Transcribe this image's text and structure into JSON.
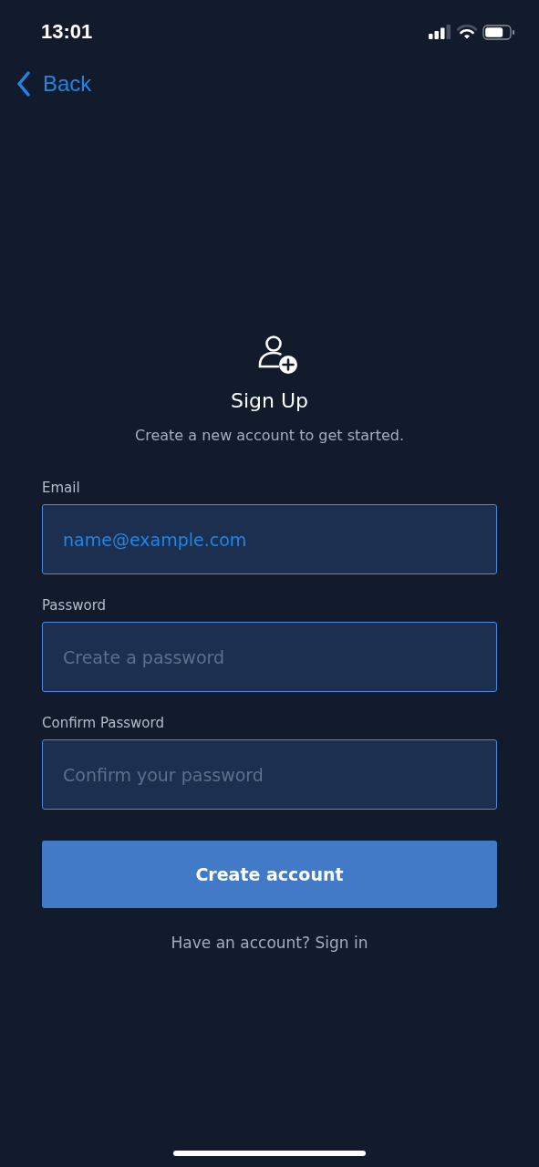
{
  "status_bar": {
    "time": "13:01"
  },
  "nav": {
    "back_label": "Back"
  },
  "header": {
    "title": "Sign Up",
    "subtitle": "Create a new account to get started."
  },
  "fields": [
    {
      "label": "Email",
      "value": "name@example.com"
    },
    {
      "label": "Password",
      "placeholder": "Create a password"
    },
    {
      "label": "Confirm Password",
      "placeholder": "Confirm your password"
    }
  ],
  "submit_button": "Create account",
  "footer_link": "Have an account? Sign in"
}
